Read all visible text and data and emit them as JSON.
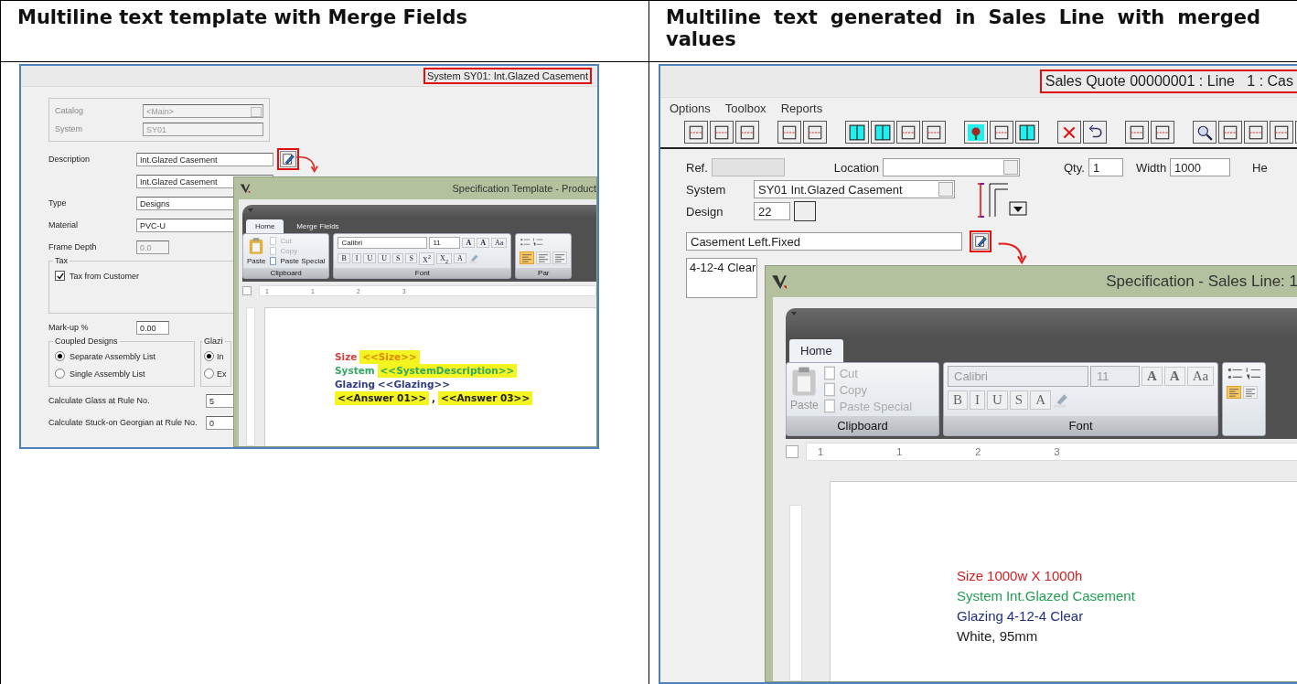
{
  "table": {
    "headers": [
      "Multiline text template with Merge Fields",
      "Multiline text generated in Sales Line with merged values"
    ]
  },
  "left_screen": {
    "title": "System SY01: Int.Glazed Casement",
    "title_highlighted": true,
    "catalog_group": [
      {
        "label": "Catalog",
        "value": "<Main>",
        "kind": "dropdown"
      },
      {
        "label": "System",
        "value": "SY01",
        "kind": "text"
      }
    ],
    "description": {
      "label": "Description",
      "value": "Int.Glazed Casement",
      "edit_highlighted": true
    },
    "fields": [
      {
        "value": "Int.Glazed Casement",
        "disabled": false
      },
      {
        "label": "Type",
        "value": "Designs",
        "disabled": false
      },
      {
        "label": "Material",
        "value": "PVC-U",
        "disabled": false
      },
      {
        "label": "Frame Depth",
        "value": "0.0",
        "disabled": true
      }
    ],
    "tax_group": {
      "legend": "Tax",
      "checkbox": {
        "label": "Tax from Customer",
        "checked": true
      }
    },
    "markup": {
      "label": "Mark-up %",
      "value": "0.00"
    },
    "coupled_group": {
      "legend": "Coupled Designs",
      "options": [
        {
          "label": "Separate Assembly List",
          "selected": true
        },
        {
          "label": "Single Assembly List",
          "selected": false
        }
      ]
    },
    "glazing_group": {
      "legend": "Glazi",
      "options": [
        {
          "label": "In",
          "selected": true
        },
        {
          "label": "Ex",
          "selected": false
        }
      ]
    },
    "rule_fields": [
      {
        "label": "Calculate Glass at Rule No.",
        "value": "5"
      },
      {
        "label": "Calculate Stuck-on Georgian at Rule No.",
        "value": "0"
      }
    ],
    "dialog": {
      "title": "Specification Template - Product",
      "tabs": [
        {
          "label": "Home",
          "selected": true
        },
        {
          "label": "Merge Fields",
          "selected": false
        }
      ],
      "paste": {
        "label": "Paste",
        "disabled": false
      },
      "clipboard_items": [
        {
          "label": "Cut",
          "disabled": true
        },
        {
          "label": "Copy",
          "disabled": true
        },
        {
          "label": "Paste Special",
          "disabled": false
        }
      ],
      "clipboard_label": "Clipboard",
      "font_name": "Calibri",
      "font_size": "11",
      "grow_buttons": [
        "A",
        "A"
      ],
      "case_button": "Aa",
      "format_buttons": [
        "B",
        "I",
        "U",
        "U",
        "S",
        "S",
        "X$^{2}$",
        "X$_{2}$",
        "A"
      ],
      "font_label": "Font",
      "paragraph_label": "Par",
      "align_buttons": [
        {
          "selected": true
        },
        {
          "selected": false
        },
        {
          "selected": false
        }
      ],
      "ruler_numbers": [
        "1",
        "1",
        "2",
        "3"
      ],
      "document_lines": [
        [
          {
            "text": "Size",
            "color": "#d04040",
            "highlight": false
          },
          {
            "text": "<<Size>>",
            "color": "#e08a00",
            "highlight": true
          }
        ],
        [
          {
            "text": "System",
            "color": "#30a860",
            "highlight": false
          },
          {
            "text": "<<SystemDescription>>",
            "color": "#30a860",
            "highlight": true
          }
        ],
        [
          {
            "text": "Glazing",
            "color": "#303c80",
            "highlight": false
          },
          {
            "text": "<<Glazing>>",
            "color": "#303c80",
            "highlight": false
          }
        ],
        [
          {
            "text": "<<Answer 01>>",
            "color": "#202020",
            "highlight": true
          },
          {
            "text": ",",
            "highlight": false
          },
          {
            "text": "<<Answer 03>>",
            "color": "#202020",
            "highlight": true
          }
        ]
      ]
    }
  },
  "right_screen": {
    "title": "Sales Quote 00000001 : Line   1 : Cas",
    "title_highlighted": true,
    "menu": [
      "Options",
      "Toolbox",
      "Reports"
    ],
    "top_fields": [
      {
        "label": "Ref.",
        "kind": "text",
        "disabled": true
      },
      {
        "label": "Location",
        "kind": "dropdown"
      },
      {
        "label": "Qty.",
        "value": "1",
        "kind": "text",
        "disabled": false
      },
      {
        "label": "Width",
        "value": "1000",
        "kind": "text",
        "disabled": false
      },
      {
        "label": "He",
        "kind": "label"
      }
    ],
    "system": {
      "label": "System",
      "value": "SY01  Int.Glazed Casement"
    },
    "design": {
      "label": "Design",
      "value": "22"
    },
    "description": {
      "value": "Casement Left.Fixed",
      "edit_highlighted": true
    },
    "glazing_value": "4-12-4 Clear",
    "dialog": {
      "title": "Specification - Sales Line: 1",
      "tabs": [
        {
          "label": "Home",
          "selected": true
        }
      ],
      "paste": {
        "label": "Paste",
        "disabled": true
      },
      "clipboard_items": [
        {
          "label": "Cut",
          "disabled": true
        },
        {
          "label": "Copy",
          "disabled": true
        },
        {
          "label": "Paste Special",
          "disabled": true
        }
      ],
      "clipboard_label": "Clipboard",
      "font_name": "Calibri",
      "font_size": "11",
      "grow_buttons": [
        "A",
        "A"
      ],
      "case_button": "Aa",
      "format_buttons": [
        "B",
        "I",
        "U",
        "S",
        "A"
      ],
      "font_label": "Font",
      "align_buttons": [
        {
          "selected": true
        },
        {
          "selected": false
        }
      ],
      "ruler_numbers": [
        "1",
        "1",
        "2",
        "3"
      ],
      "document_lines": [
        [
          {
            "text": "Size",
            "color": "#d02020",
            "highlight": false
          },
          {
            "text": "1000w X 1000h",
            "color": "#d02020",
            "highlight": false
          }
        ],
        [
          {
            "text": "System",
            "color": "#20a050",
            "highlight": false
          },
          {
            "text": "Int.Glazed Casement",
            "color": "#20a050",
            "highlight": false
          }
        ],
        [
          {
            "text": "Glazing",
            "color": "#203080",
            "highlight": false
          },
          {
            "text": "4-12-4 Clear",
            "color": "#203080",
            "highlight": false
          }
        ],
        [
          {
            "text": "White, 95mm",
            "color": "#202020",
            "highlight": false
          }
        ]
      ]
    }
  }
}
